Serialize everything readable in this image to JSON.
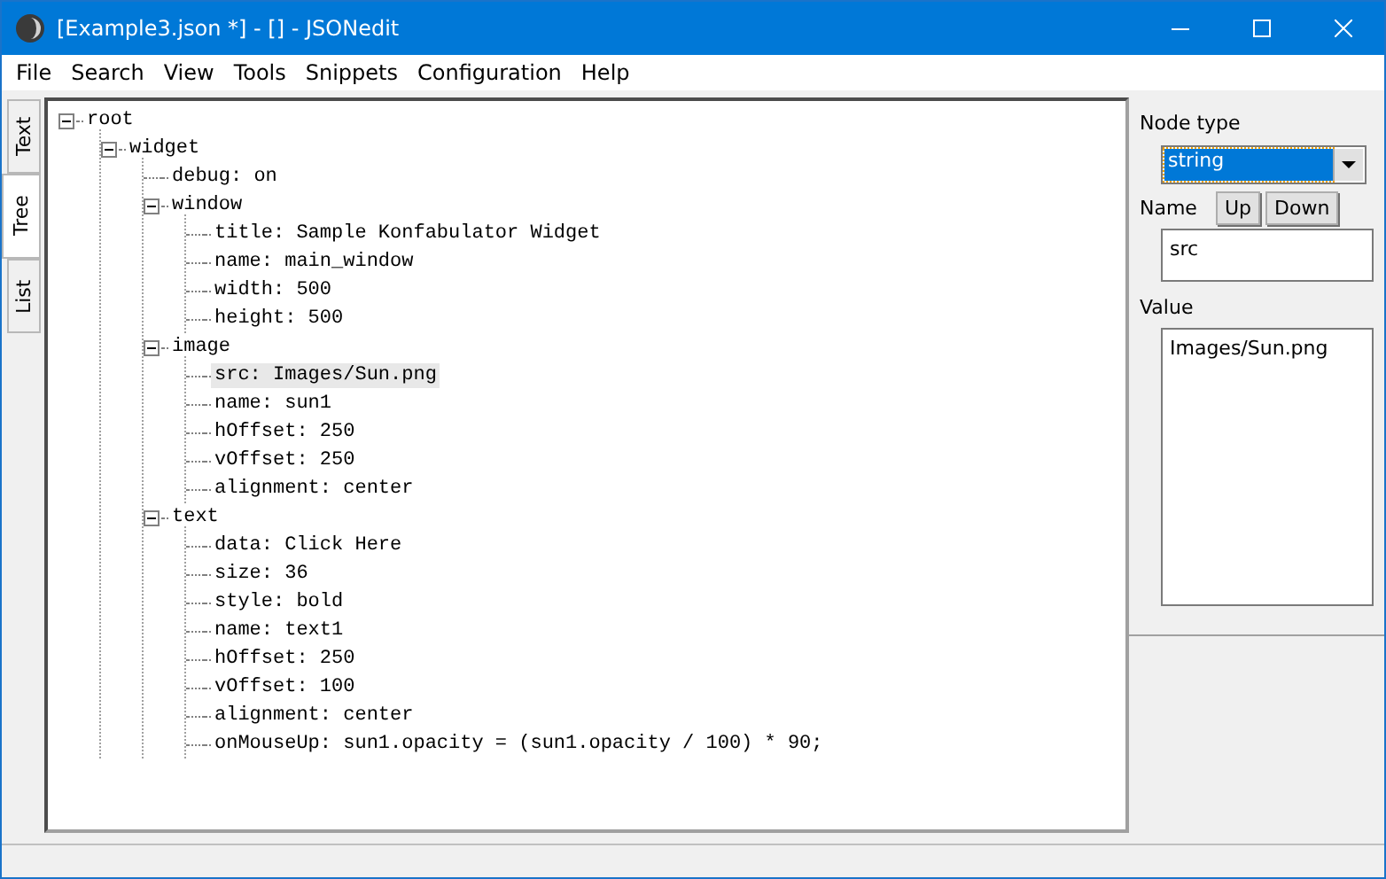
{
  "window": {
    "title": "[Example3.json *] - [] - JSONedit"
  },
  "menu": [
    "File",
    "Search",
    "View",
    "Tools",
    "Snippets",
    "Configuration",
    "Help"
  ],
  "side_tabs": [
    {
      "label": "Text",
      "selected": false
    },
    {
      "label": "Tree",
      "selected": true
    },
    {
      "label": "List",
      "selected": false
    }
  ],
  "tree": {
    "label": "root",
    "expanded": true,
    "selected": false,
    "children": [
      {
        "label": "widget",
        "expanded": true,
        "selected": false,
        "children": [
          {
            "label": "debug: on",
            "selected": false
          },
          {
            "label": "window",
            "expanded": true,
            "selected": false,
            "children": [
              {
                "label": "title: Sample Konfabulator Widget",
                "selected": false
              },
              {
                "label": "name: main_window",
                "selected": false
              },
              {
                "label": "width: 500",
                "selected": false
              },
              {
                "label": "height: 500",
                "selected": false
              }
            ]
          },
          {
            "label": "image",
            "expanded": true,
            "selected": false,
            "children": [
              {
                "label": "src: Images/Sun.png",
                "selected": true
              },
              {
                "label": "name: sun1",
                "selected": false
              },
              {
                "label": "hOffset: 250",
                "selected": false
              },
              {
                "label": "vOffset: 250",
                "selected": false
              },
              {
                "label": "alignment: center",
                "selected": false
              }
            ]
          },
          {
            "label": "text",
            "expanded": true,
            "selected": false,
            "children": [
              {
                "label": "data: Click Here",
                "selected": false
              },
              {
                "label": "size: 36",
                "selected": false
              },
              {
                "label": "style: bold",
                "selected": false
              },
              {
                "label": "name: text1",
                "selected": false
              },
              {
                "label": "hOffset: 250",
                "selected": false
              },
              {
                "label": "vOffset: 100",
                "selected": false
              },
              {
                "label": "alignment: center",
                "selected": false
              },
              {
                "label": "onMouseUp: sun1.opacity = (sun1.opacity / 100) * 90;",
                "selected": false
              }
            ]
          }
        ]
      }
    ]
  },
  "editor": {
    "node_type_label": "Node type",
    "node_type": "string",
    "name_label": "Name",
    "buttons": [
      "Up",
      "Down"
    ],
    "name": "src",
    "value_label": "Value",
    "value": "Images/Sun.png"
  }
}
